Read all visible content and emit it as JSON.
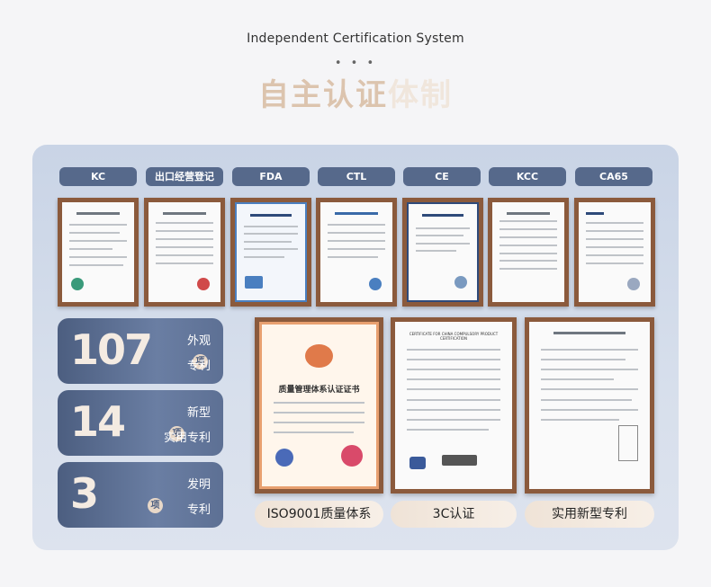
{
  "header": {
    "subtitle": "Independent Certification System",
    "dots": "• • •",
    "title_part1": "自主认证",
    "title_part2": "体制"
  },
  "tags": [
    "KC",
    "出口经营登记",
    "FDA",
    "CTL",
    "CE",
    "KCC",
    "CA65"
  ],
  "stats": [
    {
      "number": "107",
      "unit": "项",
      "label1": "外观",
      "label2": "专利"
    },
    {
      "number": "14",
      "unit": "项",
      "label1": "新型",
      "label2": "实用专利"
    },
    {
      "number": "3",
      "unit": "项",
      "label1": "发明",
      "label2": "专利"
    }
  ],
  "big_certs": {
    "iso_caption": "ISO9001质量体系",
    "ccc_caption": "3C认证",
    "patent_caption": "实用新型专利",
    "iso_title": "质量管理体系认证证书",
    "ccc_heading": "CERTIFICATE FOR CHINA COMPULSORY PRODUCT CERTIFICATION"
  },
  "colors": {
    "tag_bg": "#56698b",
    "stat_bg": "#5d7094",
    "frame": "#8b5a3c",
    "title_accent": "#dcc4ae"
  }
}
